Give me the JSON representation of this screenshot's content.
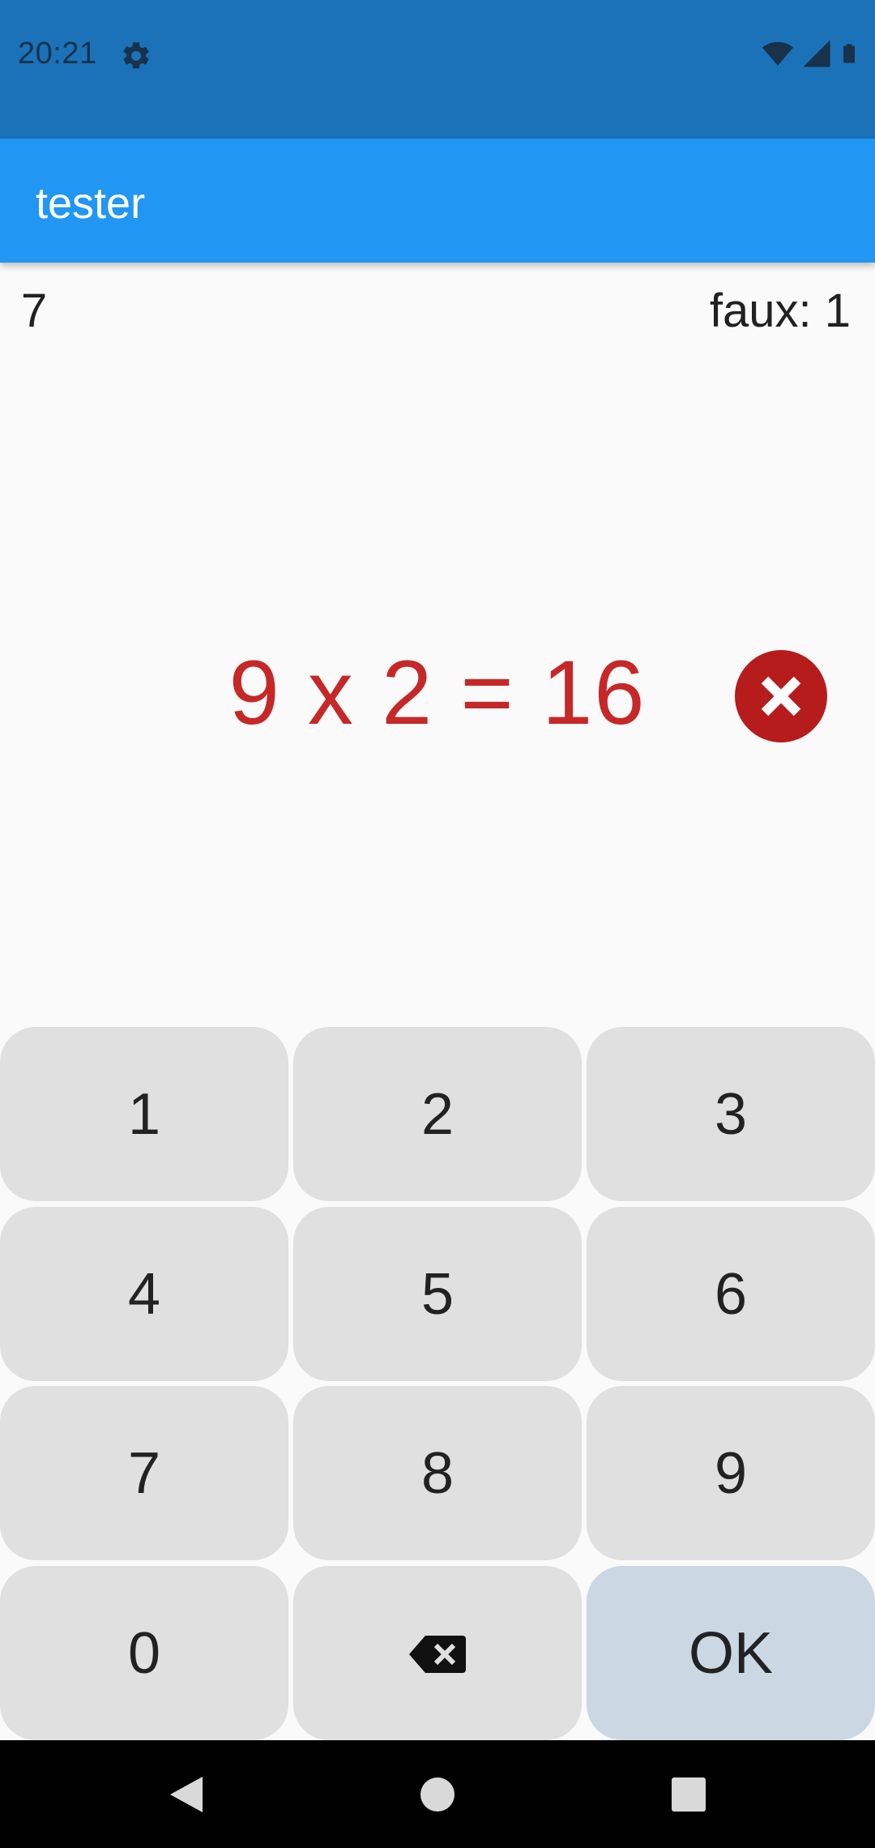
{
  "status_bar": {
    "time": "20:21",
    "icons": [
      "gear-icon",
      "wifi-icon",
      "signal-icon",
      "battery-icon"
    ]
  },
  "app_bar": {
    "title": "tester"
  },
  "score": {
    "count": "7",
    "wrong_label": "faux: 1"
  },
  "question": {
    "text": "9 x 2 = 16",
    "status_icon": "wrong-icon"
  },
  "keypad": {
    "keys": [
      "1",
      "2",
      "3",
      "4",
      "5",
      "6",
      "7",
      "8",
      "9",
      "0"
    ],
    "backspace_icon": "backspace-icon",
    "ok_label": "OK"
  },
  "nav_bar": {
    "icons": [
      "back-icon",
      "home-icon",
      "recents-icon"
    ]
  },
  "colors": {
    "status_bar": "#1b72b8",
    "app_bar": "#2196f3",
    "wrong_text": "#c62828",
    "wrong_badge": "#b71c1c",
    "key": "#e0e0e0",
    "ok_key": "#cbd8e4"
  }
}
